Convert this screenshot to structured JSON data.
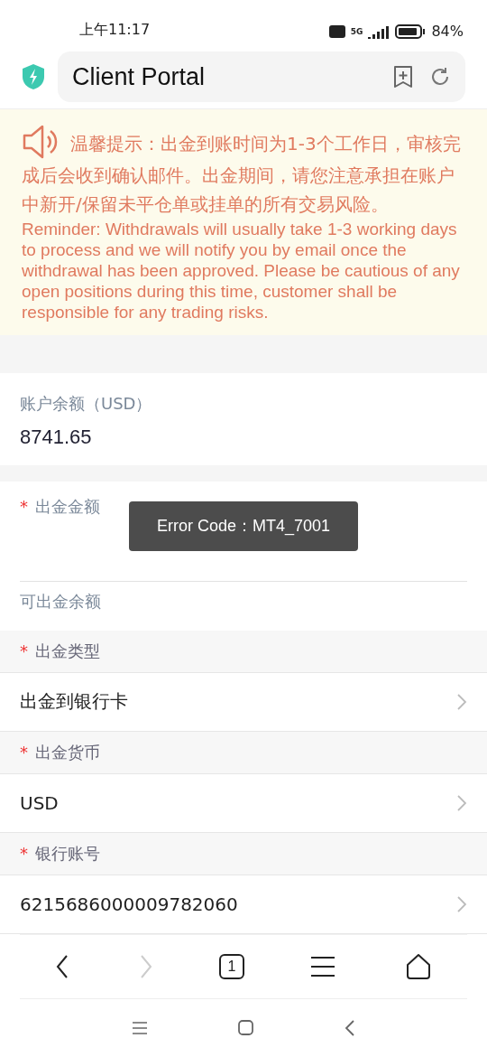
{
  "status_bar": {
    "time": "上午11:17",
    "network": "5G",
    "battery": "84%"
  },
  "browser_bar": {
    "title": "Client Portal"
  },
  "notice": {
    "text": "温馨提示：出金到账时间为1-3个工作日，审核完成后会收到确认邮件。出金期间，请您注意承担在账户中新开/保留未平仓单或挂单的所有交易风险。",
    "text_en": "Reminder: Withdrawals will usually take 1-3 working days to process and we will notify you by email once the withdrawal has been approved. Please be cautious of any open positions during this time, customer shall be responsible for any trading risks."
  },
  "balance": {
    "label": "账户余额（USD）",
    "value": "8741.65"
  },
  "amount": {
    "label": "出金金额",
    "mark": "*",
    "available_label": "可出金余额"
  },
  "toast": {
    "text": "Error Code：MT4_7001"
  },
  "fields": [
    {
      "label": "出金类型",
      "mark": "*",
      "value": "出金到银行卡"
    },
    {
      "label": "出金货币",
      "mark": "*",
      "value": "USD"
    },
    {
      "label": "银行账号",
      "mark": "*",
      "value": "6215686000009782060"
    }
  ],
  "bottom_nav": {
    "back_disabled": false,
    "forward_disabled": true,
    "tab_count": "1"
  }
}
